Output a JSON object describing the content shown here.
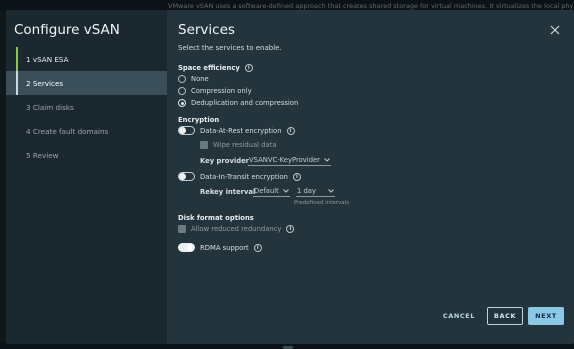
{
  "backdrop": {
    "text": "VMware vSAN uses a software-defined approach that creates shared storage for virtual machines. It virtualizes the local physical storage resources of ESXi ho"
  },
  "wizard": {
    "title": "Configure vSAN",
    "steps": [
      {
        "label": "1  vSAN ESA",
        "state": "done"
      },
      {
        "label": "2  Services",
        "state": "active"
      },
      {
        "label": "3  Claim disks",
        "state": "pending"
      },
      {
        "label": "4  Create fault domains",
        "state": "pending"
      },
      {
        "label": "5  Review",
        "state": "pending"
      }
    ]
  },
  "page": {
    "title": "Services",
    "intro": "Select the services to enable."
  },
  "space_efficiency": {
    "label": "Space efficiency",
    "options": [
      "None",
      "Compression only",
      "Deduplication and compression"
    ],
    "selected": "Deduplication and compression"
  },
  "encryption": {
    "label": "Encryption",
    "at_rest_label": "Data-At-Rest encryption",
    "at_rest_enabled": false,
    "wipe_label": "Wipe residual data",
    "key_provider_label": "Key provider",
    "key_provider_value": "VSANVC-KeyProvider",
    "in_transit_label": "Data-In-Transit encryption",
    "in_transit_enabled": false,
    "rekey_label": "Rekey interval",
    "rekey_mode": "Default",
    "rekey_value": "1 day",
    "rekey_hint": "Predefined intervals"
  },
  "disk_format": {
    "label": "Disk format options",
    "reduced_redundancy_label": "Allow reduced redundancy",
    "rdma_label": "RDMA support",
    "rdma_enabled": true
  },
  "footer": {
    "cancel": "CANCEL",
    "back": "BACK",
    "next": "NEXT"
  },
  "icons": {
    "info": "i"
  },
  "colors": {
    "accent": "#8cc8e8",
    "completed_step": "#8fc43f",
    "dialog_bg": "#24343c",
    "nav_bg": "#1b282f"
  }
}
